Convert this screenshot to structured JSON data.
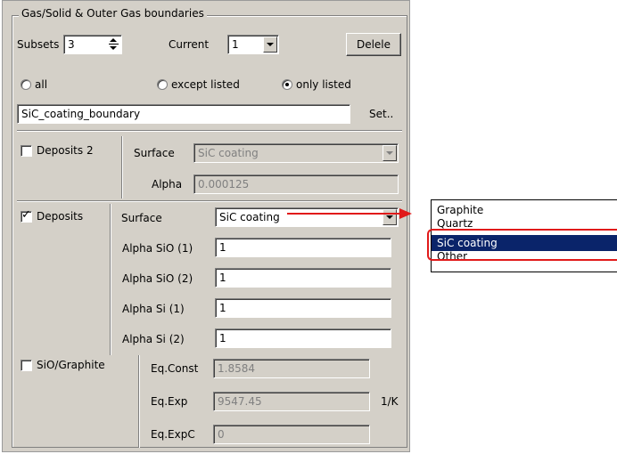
{
  "group": {
    "title": "Gas/Solid & Outer Gas boundaries"
  },
  "subsets": {
    "label": "Subsets",
    "value": "3"
  },
  "current": {
    "label": "Current",
    "value": "1"
  },
  "delete_button": {
    "label": "Delele"
  },
  "scope": {
    "all_label": "all",
    "except_label": "except listed",
    "only_label": "only listed",
    "selected": "only listed"
  },
  "boundary": {
    "value": "SiC_coating_boundary",
    "set_label": "Set.."
  },
  "deposits2": {
    "label": "Deposits 2",
    "checked": false,
    "surface_label": "Surface",
    "surface_value": "SiC coating",
    "alpha_label": "Alpha",
    "alpha_value": "0.000125"
  },
  "deposits": {
    "label": "Deposits",
    "checked": true,
    "surface_label": "Surface",
    "surface_value": "SiC coating",
    "alpha_sio1_label": "Alpha SiO (1)",
    "alpha_sio1_value": "1",
    "alpha_sio2_label": "Alpha SiO (2)",
    "alpha_sio2_value": "1",
    "alpha_si1_label": "Alpha Si (1)",
    "alpha_si1_value": "1",
    "alpha_si2_label": "Alpha Si (2)",
    "alpha_si2_value": "1"
  },
  "sio_graphite": {
    "label": "SiO/Graphite",
    "checked": false,
    "eqconst_label": "Eq.Const",
    "eqconst_value": "1.8584",
    "eqexp_label": "Eq.Exp",
    "eqexp_value": "9547.45",
    "eqexp_unit": "1/K",
    "eqexpc_label": "Eq.ExpC",
    "eqexpc_value": "0"
  },
  "surface_dropdown": {
    "options": [
      "Graphite",
      "Quartz",
      "SiC coating",
      "Other"
    ],
    "selected": "SiC coating"
  },
  "colors": {
    "highlight": "#0a246a",
    "annotation": "#e11a1a",
    "dialog_bg": "#d4d0c8"
  }
}
